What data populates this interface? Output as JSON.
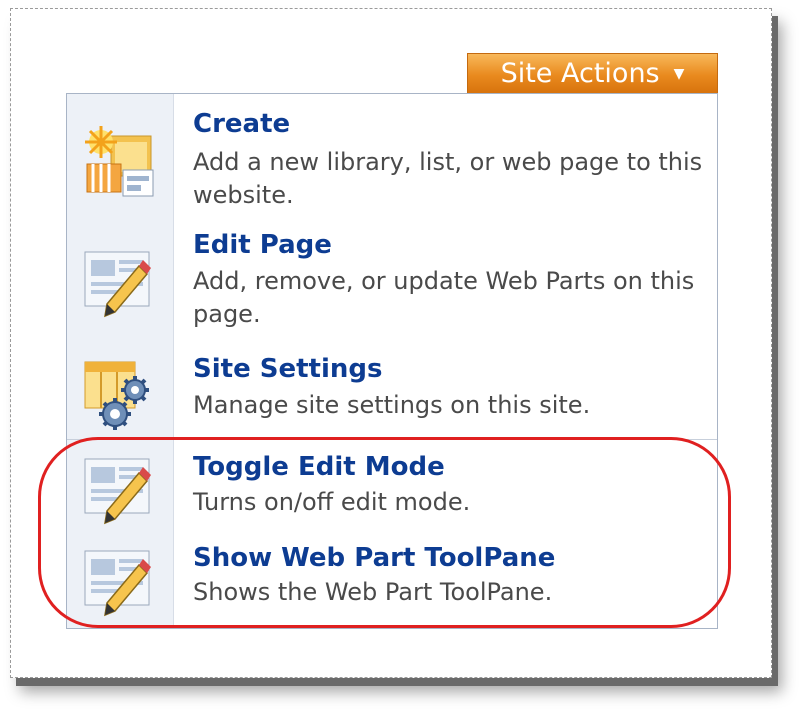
{
  "site_actions": {
    "label": "Site Actions",
    "arrow": "▼"
  },
  "menu": {
    "items": [
      {
        "title": "Create",
        "desc": "Add a new library, list, or web page to this website.",
        "icon": "create-icon"
      },
      {
        "title": "Edit Page",
        "desc": "Add, remove, or update Web Parts on this page.",
        "icon": "edit-page-icon"
      },
      {
        "title": "Site Settings",
        "desc": "Manage site settings on this site.",
        "icon": "site-settings-icon"
      },
      {
        "title": "Toggle Edit Mode",
        "desc": "Turns on/off edit mode.",
        "icon": "toggle-edit-mode-icon"
      },
      {
        "title": "Show Web Part ToolPane",
        "desc": "Shows the Web Part ToolPane.",
        "icon": "web-part-toolpane-icon"
      }
    ]
  },
  "colors": {
    "title": "#0d3c92",
    "button": "#e98a1e",
    "highlight": "#e02020"
  }
}
